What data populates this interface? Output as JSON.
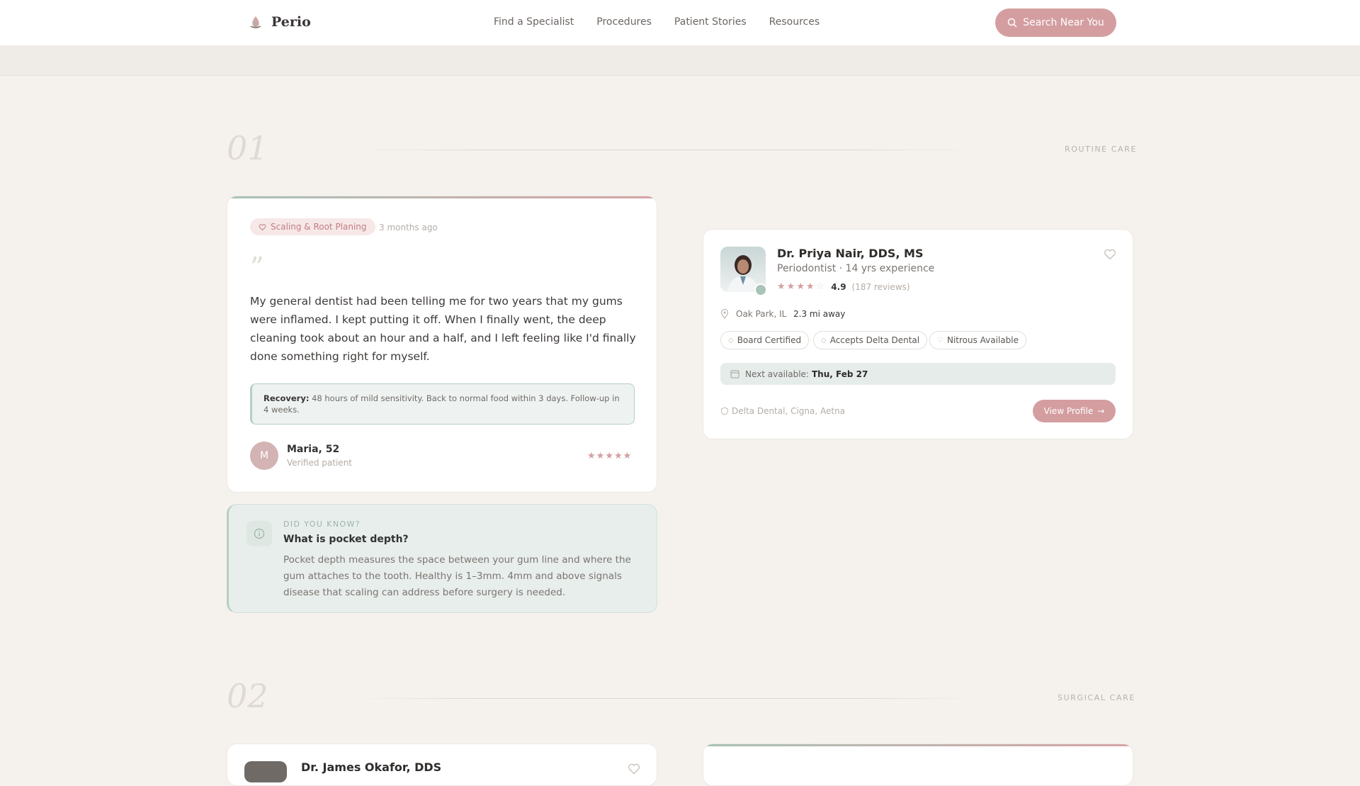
{
  "header": {
    "brand": "Perio",
    "nav": [
      "Find a Specialist",
      "Procedures",
      "Patient Stories",
      "Resources"
    ],
    "search_button": "Search Near You"
  },
  "sections": [
    {
      "number": "01",
      "label": "ROUTINE CARE"
    },
    {
      "number": "02",
      "label": "SURGICAL CARE"
    }
  ],
  "story": {
    "procedure_tag": "Scaling & Root Planing",
    "time_ago": "3 months ago",
    "quote_mark": "”",
    "text": "My general dentist had been telling me for two years that my gums were inflamed. I kept putting it off. When I finally went, the deep cleaning took about an hour and a half, and I left feeling like I'd finally done something right for myself.",
    "recovery_label": "Recovery:",
    "recovery_text": "48 hours of mild sensitivity. Back to normal food within 3 days. Follow-up in 4 weeks.",
    "author_initial": "M",
    "author_name": "Maria, 52",
    "author_status": "Verified patient",
    "rating": 5
  },
  "did_you_know": {
    "eyebrow": "DID YOU KNOW?",
    "title": "What is pocket depth?",
    "body": "Pocket depth measures the space between your gum line and where the gum attaches to the tooth. Healthy is 1–3mm. 4mm and above signals disease that scaling can address before surgery is needed."
  },
  "doctor": {
    "name": "Dr. Priya Nair, DDS, MS",
    "specialty": "Periodontist · 14 yrs experience",
    "rating_value": "4.9",
    "reviews": "(187 reviews)",
    "stars_filled": 4,
    "location": "Oak Park, IL",
    "distance": "2.3 mi away",
    "chips": [
      "Board Certified",
      "Accepts Delta Dental",
      "Nitrous Available"
    ],
    "next_available_label": "Next available:",
    "next_available_date": "Thu, Feb 27",
    "insurance": "Delta Dental, Cigna, Aetna",
    "view_profile": "View Profile"
  },
  "doctor2_partial": {
    "name": "Dr. James Okafor, DDS"
  },
  "colors": {
    "accent": "#d49ea0",
    "sage": "#a9c3b7",
    "background": "#f5f2ee"
  }
}
